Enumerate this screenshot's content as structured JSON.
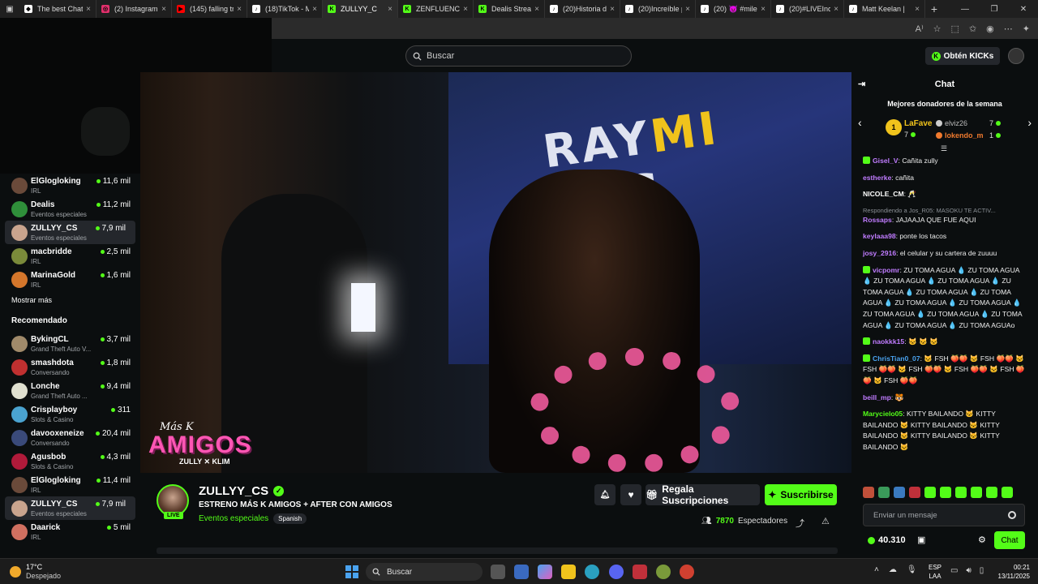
{
  "browser": {
    "tabs": [
      {
        "label": "The best Chat",
        "color": "#ffffff",
        "glyph": "◆"
      },
      {
        "label": "(2) Instagram",
        "color": "#e1306c",
        "glyph": "◎"
      },
      {
        "label": "(145) falling tr",
        "color": "#ff0000",
        "glyph": "▶"
      },
      {
        "label": "(18)TikTok - M",
        "color": "#ffffff",
        "glyph": "♪"
      },
      {
        "label": "ZULLYY_C",
        "color": "#53fc18",
        "glyph": "K"
      },
      {
        "label": "ZENFLUENCEF",
        "color": "#53fc18",
        "glyph": "K"
      },
      {
        "label": "Dealis Stream",
        "color": "#53fc18",
        "glyph": "K"
      },
      {
        "label": "(20)Historia de",
        "color": "#ffffff",
        "glyph": "♪"
      },
      {
        "label": "(20)Increíble p",
        "color": "#ffffff",
        "glyph": "♪"
      },
      {
        "label": "(20) 😈 #milen",
        "color": "#ffffff",
        "glyph": "♪"
      },
      {
        "label": "(20)#LIVEIncel",
        "color": "#ffffff",
        "glyph": "♪"
      },
      {
        "label": "Matt Keelan |",
        "color": "#ffffff",
        "glyph": "♪"
      }
    ],
    "new_tab": "+",
    "window_controls": [
      "—",
      "❐",
      "✕"
    ]
  },
  "header": {
    "search_placeholder": "Buscar",
    "get_kicks": "Obtén KICKs"
  },
  "sidebar": {
    "following": [
      {
        "name": "ElGlogloking",
        "category": "IRL",
        "viewers": "11,6 mil",
        "color": "#6a4a3a"
      },
      {
        "name": "Dealis",
        "category": "Eventos especiales",
        "viewers": "11,2 mil",
        "color": "#2f8f3a"
      },
      {
        "name": "ZULLYY_CS",
        "category": "Eventos especiales",
        "viewers": "7,9 mil",
        "color": "#c9a48e",
        "active": true
      },
      {
        "name": "macbridde",
        "category": "IRL",
        "viewers": "2,5 mil",
        "color": "#7a8a3a"
      },
      {
        "name": "MarinaGold",
        "category": "IRL",
        "viewers": "1,6 mil",
        "color": "#d4762b"
      }
    ],
    "show_more": "Mostrar más",
    "recommended_label": "Recomendado",
    "recommended": [
      {
        "name": "BykingCL",
        "category": "Grand Theft Auto V...",
        "viewers": "3,7 mil",
        "color": "#a08a6a"
      },
      {
        "name": "smashdota",
        "category": "Conversando",
        "viewers": "1,8 mil",
        "color": "#c03030"
      },
      {
        "name": "Lonche",
        "category": "Grand Theft Auto ...",
        "viewers": "9,4 mil",
        "color": "#e0e0d0"
      },
      {
        "name": "Crisplayboy",
        "category": "Slots & Casino",
        "viewers": "311",
        "color": "#4aa3d0"
      },
      {
        "name": "davooxeneize",
        "category": "Conversando",
        "viewers": "20,4 mil",
        "color": "#3a4a7a"
      },
      {
        "name": "Agusbob",
        "category": "Slots & Casino",
        "viewers": "4,3 mil",
        "color": "#b01a3a"
      },
      {
        "name": "ElGlogloking",
        "category": "IRL",
        "viewers": "11,4 mil",
        "color": "#6a4a3a"
      },
      {
        "name": "ZULLYY_CS",
        "category": "Eventos especiales",
        "viewers": "7,9 mil",
        "color": "#c9a48e",
        "active": true
      },
      {
        "name": "Daarick",
        "category": "IRL",
        "viewers": "5 mil",
        "color": "#d07060"
      }
    ]
  },
  "video": {
    "overlay_top": "Más K",
    "overlay_main": "AMIGOS",
    "overlay_sub": "ZULLY ✕ KLIM",
    "bus_text_a": "RAY",
    "bus_text_b": "MI",
    "bus_text_c": "BUS"
  },
  "stream": {
    "name": "ZULLYY_CS",
    "live": "LIVE",
    "title": "ESTRENO MÁS K AMIGOS + AFTER CON AMIGOS",
    "category": "Eventos especiales",
    "language": "Spanish",
    "gift_subs": "Regala Suscripciones",
    "subscribe": "Suscribirse",
    "viewers_count": "7870",
    "viewers_label": "Espectadores"
  },
  "chat": {
    "title": "Chat",
    "donors_title": "Mejores donadores de la semana",
    "donor1": {
      "rank": "1",
      "name": "LaFave",
      "value": "7"
    },
    "donor2": {
      "name": "elviz26",
      "value": "7"
    },
    "donor3": {
      "name": "lokendo_m",
      "value": "1"
    },
    "messages": [
      {
        "user": "Gisel_V",
        "color": "#c07cff",
        "badge": true,
        "text": "Cañita zully"
      },
      {
        "user": "estherke",
        "color": "#c07cff",
        "text": "cañita"
      },
      {
        "user": "NICOLE_CM",
        "color": "#ffffff",
        "text": "🥂"
      },
      {
        "user": "Rossaps",
        "color": "#c07cff",
        "reply": "Respondiendo a Jos_R05: MASOKU TE ACTIV...",
        "text": "JAJAAJA QUE FUE AQUI"
      },
      {
        "user": "keylaaa98",
        "color": "#c07cff",
        "text": "ponte los tacos"
      },
      {
        "user": "josy_2916",
        "color": "#c07cff",
        "text": "el celular y su cartera de zuuuu"
      },
      {
        "user": "vicpomr",
        "color": "#c07cff",
        "badge": true,
        "text": "ZU TOMA AGUA 💧 ZU TOMA AGUA 💧 ZU TOMA AGUA 💧 ZU TOMA AGUA 💧 ZU TOMA AGUA 💧 ZU TOMA AGUA 💧 ZU TOMA AGUA 💧 ZU TOMA AGUA 💧 ZU TOMA AGUA 💧 ZU TOMA AGUA 💧 ZU TOMA AGUA 💧 ZU TOMA AGUA 💧 ZU TOMA AGUA 💧 ZU TOMA AGUAo"
      },
      {
        "user": "naokkk15",
        "color": "#c07cff",
        "badge": true,
        "text": "🐱 🐱 🐱"
      },
      {
        "user": "ChrisTian0_07",
        "color": "#4aa3f0",
        "badge": true,
        "text": "🐱 FSH 🍑🍑 🐱 FSH 🍑🍑 🐱 FSH 🍑🍑 🐱 FSH 🍑🍑 🐱 FSH 🍑🍑 🐱 FSH 🍑🍑 🐱 FSH 🍑🍑"
      },
      {
        "user": "beill_mp",
        "color": "#c07cff",
        "text": "🐯"
      },
      {
        "user": "Marycielo05",
        "color": "#53fc18",
        "text": "KITTY BAILANDO 🐱 KITTY BAILANDO 🐱 KITTY BAILANDO 🐱 KITTY BAILANDO 🐱 KITTY BAILANDO 🐱 KITTY BAILANDO 🐱"
      }
    ],
    "input_placeholder": "Enviar un mensaje",
    "points": "40.310",
    "send": "Chat"
  },
  "taskbar": {
    "temp": "17°C",
    "weather": "Despejado",
    "search": "Buscar",
    "lang1": "ESP",
    "lang2": "LAA",
    "time": "00:21",
    "date": "13/11/2025"
  }
}
